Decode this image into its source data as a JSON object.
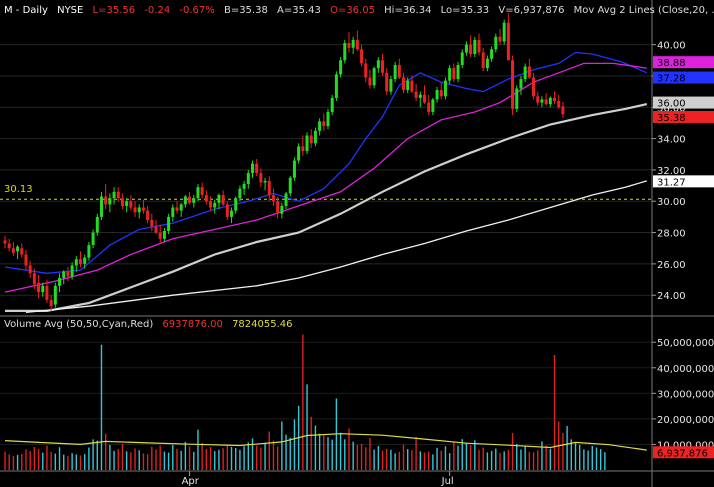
{
  "header": {
    "symbol": "M - Daily",
    "exchange": "NYSE",
    "last": "L=35.56",
    "change": "-0.24",
    "change_pct": "-0.67%",
    "bid": "B=35.38",
    "ask": "A=35.43",
    "open": "O=36.05",
    "high": "Hi=36.34",
    "low": "Lo=35.33",
    "volume": "V=6,937,876",
    "study": "Mov Avg 2 Lines (Close,20, ..."
  },
  "volume_header": {
    "study": "Volume Avg (50,50,Cyan,Red)",
    "value1": "6937876.00",
    "value2": "7824055.46"
  },
  "reference_line": {
    "label": "30.13",
    "value": 30.13
  },
  "colors": {
    "up": "#22dd22",
    "down": "#ee2222",
    "ma20": "#2233ff",
    "ma50": "#dd22dd",
    "ma100": "#cfcfcf",
    "ma200": "#f0f0f0",
    "vol_avg": "#dddd44",
    "vol_up": "#33c8d8",
    "vol_down": "#dd2222",
    "ref": "#dddd00"
  },
  "chart_data": {
    "type": "candlestick",
    "price_axis": {
      "ticks": [
        "40.00",
        "38.00",
        "36.00",
        "34.00",
        "32.00",
        "30.00",
        "28.00",
        "26.00",
        "24.00"
      ],
      "range": [
        22.8,
        41.7
      ]
    },
    "volume_axis": {
      "ticks": [
        "50,000,000",
        "40,000,000",
        "30,000,000",
        "20,000,000",
        "10,000,000"
      ],
      "range": [
        0,
        54000000
      ]
    },
    "x_axis_labels": [
      {
        "label": "Apr",
        "index": 44
      },
      {
        "label": "Jul",
        "index": 106
      }
    ],
    "price_labels": [
      {
        "text": "38.88",
        "value": 38.88,
        "bg": "#dd22dd",
        "fg": "#000000"
      },
      {
        "text": "37.28",
        "value": 37.9,
        "bg": "#2233ff",
        "fg": "#000000"
      },
      {
        "text": "36.00",
        "value": 36.3,
        "bg": "#cfcfcf",
        "fg": "#000000"
      },
      {
        "text": "35.38",
        "value": 35.38,
        "bg": "#ee2222",
        "fg": "#000000"
      },
      {
        "text": "31.27",
        "value": 31.27,
        "bg": "#ffffff",
        "fg": "#000000"
      }
    ],
    "volume_label": {
      "text": "6,937,876",
      "value": 6937876,
      "bg": "#ee2222",
      "fg": "#000000"
    },
    "ma_lines": [
      {
        "name": "MA20",
        "color": "#2233ff",
        "points": [
          [
            0,
            25.8
          ],
          [
            10,
            25.4
          ],
          [
            18,
            25.6
          ],
          [
            25,
            27.2
          ],
          [
            32,
            28.2
          ],
          [
            40,
            28.6
          ],
          [
            50,
            29.5
          ],
          [
            58,
            30.0
          ],
          [
            64,
            30.5
          ],
          [
            70,
            30.0
          ],
          [
            76,
            30.8
          ],
          [
            82,
            32.4
          ],
          [
            86,
            34.0
          ],
          [
            90,
            35.4
          ],
          [
            94,
            37.4
          ],
          [
            99,
            38.2
          ],
          [
            104,
            37.6
          ],
          [
            110,
            37.2
          ],
          [
            114,
            37.0
          ],
          [
            120,
            37.8
          ],
          [
            126,
            38.4
          ],
          [
            132,
            38.8
          ],
          [
            136,
            39.5
          ],
          [
            140,
            39.4
          ],
          [
            147,
            38.9
          ],
          [
            153,
            38.2
          ]
        ]
      },
      {
        "name": "MA50",
        "color": "#dd22dd",
        "points": [
          [
            0,
            24.2
          ],
          [
            12,
            24.9
          ],
          [
            22,
            25.6
          ],
          [
            30,
            26.6
          ],
          [
            40,
            27.6
          ],
          [
            50,
            28.2
          ],
          [
            60,
            28.8
          ],
          [
            70,
            29.7
          ],
          [
            80,
            30.6
          ],
          [
            88,
            32.1
          ],
          [
            96,
            34.0
          ],
          [
            104,
            35.2
          ],
          [
            112,
            35.7
          ],
          [
            118,
            36.3
          ],
          [
            126,
            37.6
          ],
          [
            132,
            38.2
          ],
          [
            138,
            38.8
          ],
          [
            145,
            38.8
          ],
          [
            153,
            38.5
          ]
        ]
      },
      {
        "name": "MA100",
        "color": "#cfcfcf",
        "points": [
          [
            0,
            23.0
          ],
          [
            10,
            23.0
          ],
          [
            20,
            23.5
          ],
          [
            30,
            24.5
          ],
          [
            40,
            25.5
          ],
          [
            50,
            26.6
          ],
          [
            60,
            27.4
          ],
          [
            70,
            28.0
          ],
          [
            80,
            29.2
          ],
          [
            90,
            30.6
          ],
          [
            100,
            31.9
          ],
          [
            110,
            33.0
          ],
          [
            120,
            34.0
          ],
          [
            130,
            34.9
          ],
          [
            140,
            35.5
          ],
          [
            148,
            35.9
          ],
          [
            153,
            36.2
          ]
        ]
      },
      {
        "name": "MA200",
        "color": "#f0f0f0",
        "points": [
          [
            5,
            22.9
          ],
          [
            20,
            23.3
          ],
          [
            40,
            24.0
          ],
          [
            60,
            24.6
          ],
          [
            70,
            25.1
          ],
          [
            80,
            25.8
          ],
          [
            90,
            26.6
          ],
          [
            100,
            27.3
          ],
          [
            110,
            28.1
          ],
          [
            120,
            28.8
          ],
          [
            130,
            29.6
          ],
          [
            140,
            30.4
          ],
          [
            148,
            30.9
          ],
          [
            153,
            31.3
          ]
        ]
      }
    ],
    "candles_ohlc_compact": "27.5,27.8,27.0,27.3;27.3,27.6,26.8,27.0;27.0,27.4,26.5,26.7;26.8,27.2,26.3,27.1;27.0,27.3,26.4,26.6;26.6,26.9,25.6,25.9;25.9,26.2,25.1,25.4;25.4,25.7,24.4,24.7;24.8,25.3,23.8,24.2;24.2,24.8,23.9,24.6;24.6,25.0,23.5,23.7;23.7,24.0,23.0,23.3;23.4,24.8,23.2,24.6;24.6,25.4,24.2,25.1;25.1,25.6,24.7,25.5;25.5,25.8,24.9,25.2;25.2,26.1,25.0,25.9;25.9,26.5,25.5,26.3;26.3,26.8,25.8,26.0;26.0,26.6,25.7,26.4;26.4,27.4,26.2,27.2;27.2,28.2,27.0,28.0;28.0,29.2,27.8,29.0;29.0,30.6,28.8,30.3;30.3,31.1,29.5,29.8;29.8,30.5,29.3,30.2;30.2,30.9,29.8,30.6;30.6,30.9,30.0,30.2;30.2,30.5,29.5,29.7;29.7,30.2,29.3,30.0;30.0,30.4,29.4,29.6;29.6,30.0,29.0,29.3;29.3,29.8,28.9,29.6;29.6,30.1,29.2,29.4;29.4,29.7,28.6,28.8;28.8,29.2,28.1,28.4;28.4,28.8,27.9,28.0;28.0,28.5,27.3,27.6;27.6,28.3,27.4,28.1;28.1,29.2,27.9,29.0;29.0,29.8,28.7,29.6;29.6,30.0,29.2,29.4;29.4,29.9,29.0,29.8;29.8,30.4,29.6,30.3;30.3,30.6,29.8,29.9;29.9,30.4,29.6,30.2;30.2,31.1,30.0,30.9;30.9,31.2,30.2,30.4;30.4,30.7,29.8,30.0;30.0,30.3,29.4,29.6;29.6,30.1,29.2,29.9;29.9,30.5,29.5,30.4;30.4,30.7,29.7,29.8;29.8,30.0,28.8,29.0;29.0,29.6,28.6,29.4;29.4,30.3,29.2,30.2;30.2,31.0,30.0,30.8;30.8,31.3,30.4,31.1;31.1,32.0,30.8,31.8;31.8,32.6,31.5,32.4;32.4,32.7,31.6,31.8;31.8,32.1,30.9,31.2;31.2,31.5,30.7,31.3;31.3,31.6,30.0,30.4;30.4,30.8,29.7,30.0;30.0,30.3,28.9,29.2;29.2,29.9,28.9,29.7;29.7,30.6,29.5,30.5;30.5,31.6,30.3,31.5;31.5,32.8,31.3,32.6;32.6,33.7,32.4,33.5;33.5,34.2,32.9,33.2;33.2,34.4,33.0,34.2;34.2,34.6,33.4,33.7;33.7,34.7,33.5,34.5;34.5,35.3,34.2,35.1;35.1,35.6,34.5,34.8;34.8,35.9,34.6,35.7;35.7,36.8,35.5,36.6;36.6,38.3,36.4,38.1;38.1,39.2,37.9,39.0;39.0,40.3,38.8,40.1;40.1,40.8,39.5,39.8;39.8,40.5,39.4,40.3;40.3,40.9,39.6,39.7;39.7,40.0,38.6,38.8;38.8,39.1,37.6,37.9;37.9,38.4,37.2,37.4;37.4,38.6,37.2,38.5;38.5,39.2,38.2,39.0;39.0,39.4,38.0,38.2;38.2,38.5,36.8,37.0;37.0,38.0,36.8,37.8;37.8,38.9,37.6,38.7;38.7,39.1,37.8,37.9;37.9,38.2,36.9,37.1;37.1,37.9,36.9,37.7;37.7,38.0,36.9,37.0;37.0,37.5,36.4,36.6;36.6,37.0,36.0,36.8;36.8,37.4,36.2,36.3;36.3,36.8,35.5,35.7;35.7,36.6,35.5,36.5;36.5,37.3,36.3,37.1;37.1,37.6,36.5,36.7;36.7,37.9,36.5,37.7;37.7,38.7,37.5,38.5;38.5,38.8,37.6,37.8;37.8,38.9,37.6,38.7;38.7,39.7,38.5,39.5;39.5,40.2,39.3,40.0;40.0,40.6,39.2,39.4;39.4,40.5,39.2,40.3;40.3,40.7,39.3,39.5;39.5,39.8,38.3,38.5;38.5,39.3,38.3,39.1;39.1,39.9,38.9,39.7;39.7,40.7,39.5,40.5;40.5,41.0,40.0,40.2;40.2,41.6,40.0,41.4;41.4,42.0,40.8,39.0;39.0,39.3,35.5,35.9;35.9,37.4,35.7,37.2;37.2,38.0,36.8,37.8;37.8,38.8,37.6,38.6;38.6,39.1,37.8,37.9;37.9,38.2,36.5,36.7;36.7,37.0,36.1,36.3;36.3,36.7,36.0,36.5;36.5,36.9,36.1,36.2;36.2,36.7,36.0,36.6;36.6,37.0,36.2,36.4;36.4,36.8,35.9,36.0;36.05,36.34,35.33,35.56",
    "volume_compact": "7.2,6.1,5.5,5.9,6.3,8.1,7.4,9.0,8.2,6.8,9.5,7.1,6.4,8.9,6.0,5.5,6.6,6.1,5.7,6.2,8.8,12.0,11.5,49.0,14.2,9.8,7.5,8.1,10.2,7.3,6.9,8.4,7.7,6.5,6.2,9.1,8.0,9.6,7.2,6.8,9.8,8.3,7.5,11.0,9.2,7.1,15.8,10.6,8.2,9.0,7.4,7.9,8.5,10.1,9.0,8.6,7.9,9.3,10.8,12.4,9.5,8.8,10.7,15.1,11.5,9.2,19.0,13.8,12.6,19.8,25.1,53.0,33.5,20.8,17.4,14.2,13.5,12.8,11.9,28.0,14.6,12.0,16.2,11.1,9.8,10.3,8.9,12.5,8.0,9.4,7.6,8.3,7.9,6.5,7.1,9.9,8.2,7.7,12.9,7.3,6.8,7.2,6.1,8.7,7.6,9.3,6.6,10.8,9.5,12.1,10.4,9.8,11.6,7.9,8.8,6.9,7.5,8.4,6.7,7.3,7.8,14.5,10.2,8.0,9.4,7.1,6.9,7.7,11.2,9.6,8.3,45.0,19.0,14.5,17.2,12.0,10.5,9.8,8.1,7.6,9.4,8.8,8.2,6.94",
    "volume_avg_points": [
      [
        0,
        11.5
      ],
      [
        8,
        10.8
      ],
      [
        18,
        10.0
      ],
      [
        24,
        11.2
      ],
      [
        34,
        10.6
      ],
      [
        44,
        10.1
      ],
      [
        56,
        9.6
      ],
      [
        66,
        11.0
      ],
      [
        72,
        13.5
      ],
      [
        80,
        14.2
      ],
      [
        90,
        13.6
      ],
      [
        100,
        12.1
      ],
      [
        110,
        10.5
      ],
      [
        120,
        9.7
      ],
      [
        130,
        8.8
      ],
      [
        136,
        10.8
      ],
      [
        144,
        9.9
      ],
      [
        153,
        7.8
      ]
    ]
  }
}
